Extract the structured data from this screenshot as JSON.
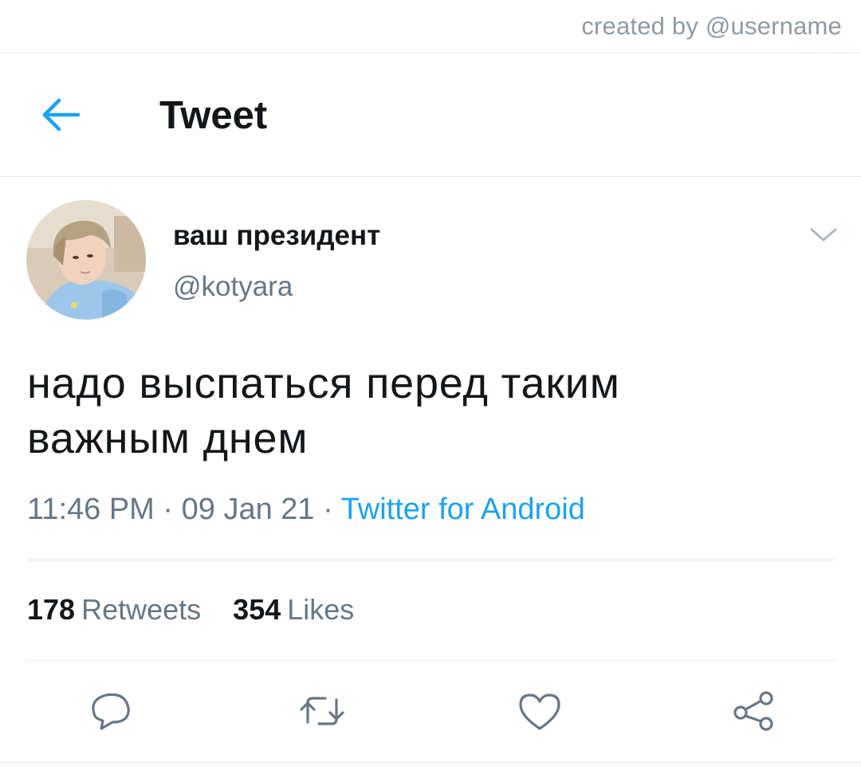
{
  "credit": {
    "text": "created by @username"
  },
  "header": {
    "back_icon": "arrow-left-icon",
    "title": "Tweet",
    "accent_color": "#1da1f2"
  },
  "tweet": {
    "author": {
      "display_name": "ваш президент",
      "handle": "@kotyara",
      "avatar": "profile-photo"
    },
    "more_icon": "chevron-down-icon",
    "text_line_1": "надо выспаться перед таким",
    "text_line_2": "важным днем",
    "time": "11:46 PM",
    "separator": "·",
    "date": "09 Jan 21",
    "source": "Twitter for Android",
    "stats": {
      "retweets_count": "178",
      "retweets_label": "Retweets",
      "likes_count": "354",
      "likes_label": "Likes"
    },
    "actions": [
      {
        "name": "reply",
        "icon": "reply-icon"
      },
      {
        "name": "retweet",
        "icon": "retweet-icon"
      },
      {
        "name": "like",
        "icon": "heart-icon"
      },
      {
        "name": "share",
        "icon": "share-icon"
      }
    ]
  },
  "colors": {
    "text_primary": "#14171a",
    "text_secondary": "#657786",
    "link": "#1da1f2",
    "divider": "#e1e8ed"
  }
}
